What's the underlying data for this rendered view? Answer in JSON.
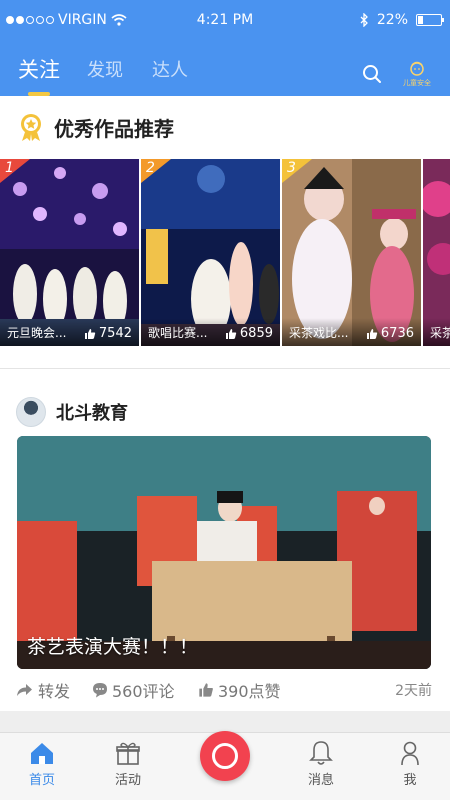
{
  "status_bar": {
    "carrier": "VIRGIN",
    "time": "4:21 PM",
    "battery": "22%",
    "battery_level": 0.22
  },
  "top_nav": {
    "tabs": [
      {
        "label": "关注",
        "active": true
      },
      {
        "label": "发现",
        "active": false
      },
      {
        "label": "达人",
        "active": false
      }
    ],
    "child_safety_label": "儿童安全"
  },
  "recommend": {
    "title": "优秀作品推荐",
    "items": [
      {
        "rank": "1",
        "title": "元旦晚会...",
        "likes": "7542",
        "rank_color": "#e8493c"
      },
      {
        "rank": "2",
        "title": "歌唱比赛...",
        "likes": "6859",
        "rank_color": "#f39a2b"
      },
      {
        "rank": "3",
        "title": "采茶戏比...",
        "likes": "6736",
        "rank_color": "#f4c23a"
      },
      {
        "rank": "",
        "title": "采茶",
        "likes": "",
        "rank_color": ""
      }
    ]
  },
  "post": {
    "author": "北斗教育",
    "title": "茶艺表演大赛！！！",
    "share_label": "转发",
    "comments_label": "560评论",
    "likes_label": "390点赞",
    "time": "2天前"
  },
  "bottom_tabs": [
    {
      "label": "首页",
      "icon": "home-icon",
      "active": true
    },
    {
      "label": "活动",
      "icon": "gift-icon",
      "active": false
    },
    {
      "label": "",
      "icon": "camera-icon",
      "active": false
    },
    {
      "label": "消息",
      "icon": "bell-icon",
      "active": false
    },
    {
      "label": "我",
      "icon": "person-icon",
      "active": false
    }
  ],
  "colors": {
    "accent": "#4a93f0",
    "highlight": "#f4c842",
    "record": "#f2424f"
  }
}
